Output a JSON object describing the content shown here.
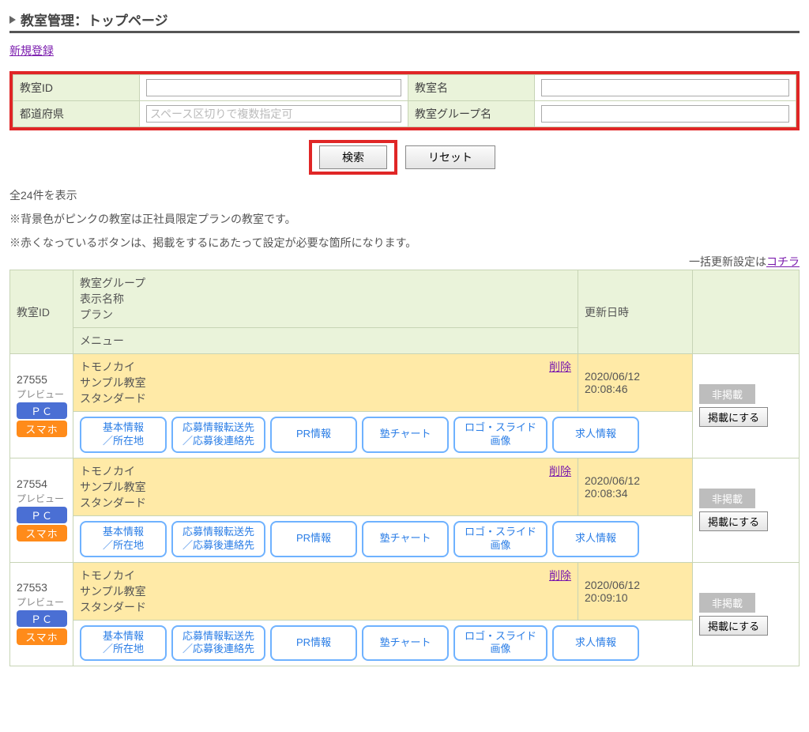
{
  "header": {
    "title": "教室管理：トップページ"
  },
  "new_link": "新規登録",
  "search": {
    "id_label": "教室ID",
    "name_label": "教室名",
    "pref_label": "都道府県",
    "pref_placeholder": "スペース区切りで複数指定可",
    "group_label": "教室グループ名",
    "btn_search": "検索",
    "btn_reset": "リセット"
  },
  "count_text": "全24件を表示",
  "notes": [
    "※背景色がピンクの教室は正社員限定プランの教室です。",
    "※赤くなっているボタンは、掲載をするにあたって設定が必要な箇所になります。"
  ],
  "batch_link_prefix": "一括更新設定は",
  "batch_link": "コチラ",
  "headers": {
    "id": "教室ID",
    "group": "教室グループ",
    "display": "表示名称",
    "plan": "プラン",
    "updated": "更新日時",
    "menu": "メニュー"
  },
  "preview_text": "プレビュー",
  "badge_pc": "ＰＣ",
  "badge_sp": "スマホ",
  "delete_text": "削除",
  "unlisted_text": "非掲載",
  "publish_text": "掲載にする",
  "menu_buttons": [
    "基本情報<br>／所在地",
    "応募情報転送先<br>／応募後連絡先",
    "PR情報",
    "塾チャート",
    "ロゴ・スライド<br>画像",
    "求人情報"
  ],
  "rows": [
    {
      "id": "27555",
      "group": "トモノカイ",
      "display": "サンプル教室",
      "plan": "スタンダード",
      "updated_date": "2020/06/12",
      "updated_time": "20:08:46"
    },
    {
      "id": "27554",
      "group": "トモノカイ",
      "display": "サンプル教室",
      "plan": "スタンダード",
      "updated_date": "2020/06/12",
      "updated_time": "20:08:34"
    },
    {
      "id": "27553",
      "group": "トモノカイ",
      "display": "サンプル教室",
      "plan": "スタンダード",
      "updated_date": "2020/06/12",
      "updated_time": "20:09:10"
    }
  ]
}
